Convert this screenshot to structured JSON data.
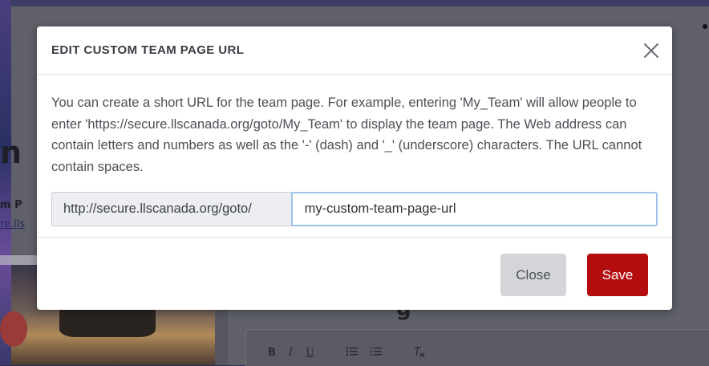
{
  "dialog": {
    "title": "EDIT CUSTOM TEAM PAGE URL",
    "help_text": "You can create a short URL for the team page. For example, entering 'My_Team' will allow people to enter 'https://secure.llscanada.org/goto/My_Team' to display the team page. The Web address can contain letters and numbers as well as the '-' (dash) and '_' (underscore) characters. The URL cannot contain spaces.",
    "url_prefix": "http://secure.llscanada.org/goto/",
    "url_value": "my-custom-team-page-url",
    "close_label": "Close",
    "save_label": "Save",
    "close_icon": "close-icon"
  },
  "background": {
    "heading_fragment": "n",
    "name_fragment": "m P",
    "link_fragment": "re.lls",
    "tail_fragment": "g",
    "toolbar": [
      "B",
      "I",
      "U",
      "ordered-list-icon",
      "bulleted-list-icon",
      "clear-format-icon"
    ]
  },
  "colors": {
    "save_button": "#b30d0d",
    "close_button": "#d3d5d8",
    "input_focus_border": "#9ec3ea",
    "overlay": "#5f6069"
  }
}
